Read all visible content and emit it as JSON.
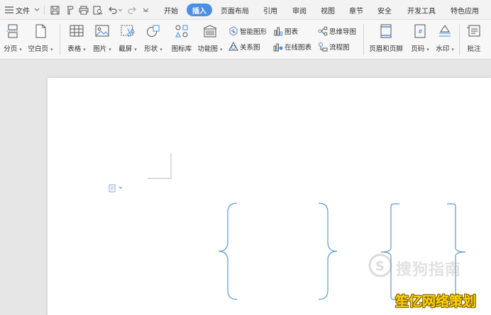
{
  "menubar": {
    "file_label": "文件",
    "tabs": [
      "开始",
      "插入",
      "页面布局",
      "引用",
      "审阅",
      "视图",
      "章节",
      "安全",
      "开发工具",
      "特色应用"
    ],
    "active_tab": "插入"
  },
  "ribbon": {
    "page_break": "分页",
    "blank_page": "空白页",
    "table": "表格",
    "picture": "图片",
    "screenshot": "截屏",
    "shape": "形状",
    "icon_library": "图标库",
    "function_chart": "功能图",
    "smart_graphic": "智能图形",
    "chart": "图表",
    "mind_map": "思维导图",
    "relationship": "关系图",
    "online_chart": "在线图表",
    "flowchart": "流程图",
    "header_footer": "页眉和页脚",
    "page_number": "页码",
    "watermark": "水印",
    "comment": "批注"
  },
  "watermark_text": "搜狗指南",
  "brand_text": "笙亿网络策划",
  "colors": {
    "accent": "#4a8fe3",
    "brace": "#5b9bd5",
    "brand": "#ffd400"
  }
}
